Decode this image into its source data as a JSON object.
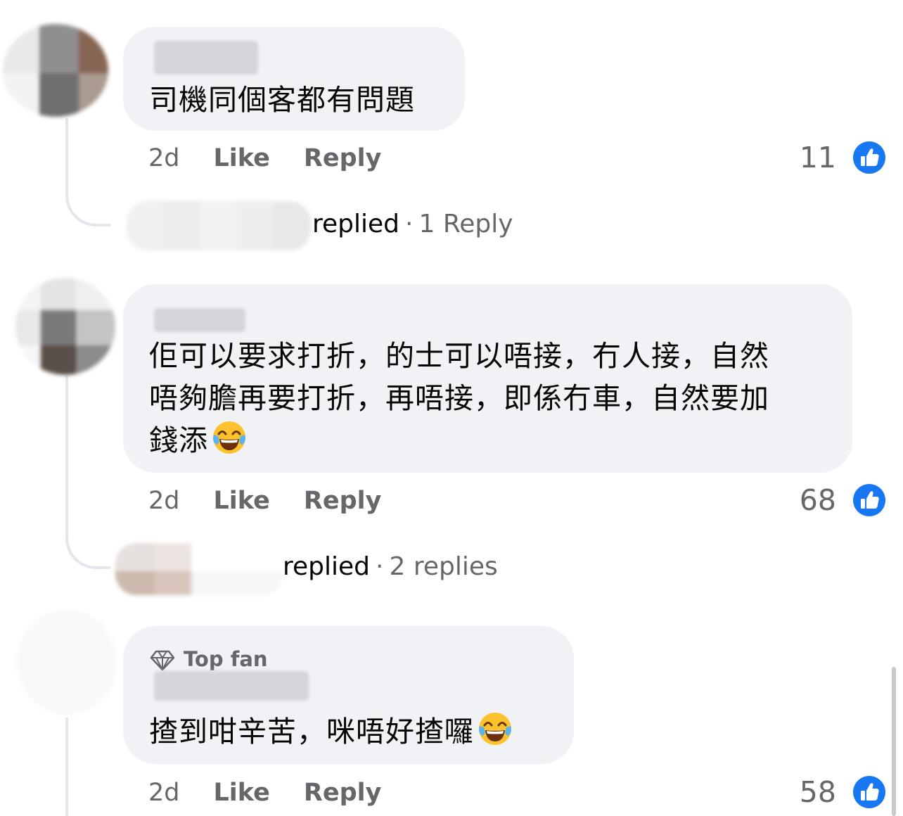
{
  "comments": [
    {
      "text": "司機同個客都有問題",
      "time": "2d",
      "like_label": "Like",
      "reply_label": "Reply",
      "reaction_count": "11",
      "replies": {
        "replied_label": "replied",
        "separator": "·",
        "count_label": "1 Reply"
      }
    },
    {
      "text_lines": [
        "佢可以要求打折，的士可以唔接，冇人接，自然",
        "唔夠膽再要打折，再唔接，即係冇車，自然要加",
        "錢添"
      ],
      "emoji": "face-with-tears-of-joy-icon",
      "time": "2d",
      "like_label": "Like",
      "reply_label": "Reply",
      "reaction_count": "68",
      "replies": {
        "replied_label": "replied",
        "separator": "·",
        "count_label": "2 replies"
      }
    },
    {
      "badge": "Top fan",
      "text": "揸到咁辛苦，咪唔好揸囉",
      "emoji": "face-with-tears-of-joy-icon",
      "time": "2d",
      "like_label": "Like",
      "reply_label": "Reply",
      "reaction_count": "58"
    }
  ],
  "colors": {
    "bubble": "#f0f2f5",
    "secondary_text": "#65676b",
    "like_blue": "#1877f2",
    "thread_line": "#e4e6eb"
  }
}
